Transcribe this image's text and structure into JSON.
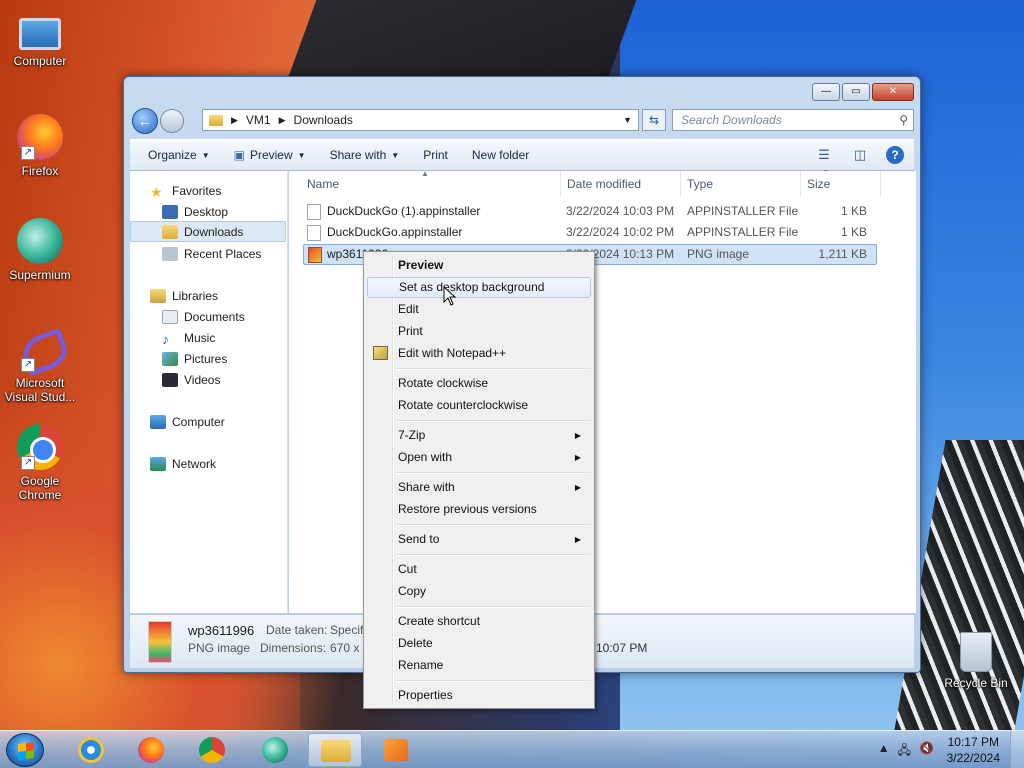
{
  "desktop": {
    "icons": [
      {
        "label": "Computer"
      },
      {
        "label": "Firefox"
      },
      {
        "label": "Supermium"
      },
      {
        "label": "Microsoft Visual Stud..."
      },
      {
        "label": "Google Chrome"
      },
      {
        "label": "Recycle Bin"
      }
    ]
  },
  "window": {
    "controls": {
      "minimize": "—",
      "maximize": "▭",
      "close": "✕"
    },
    "address": {
      "segments": [
        "VM1",
        "Downloads"
      ]
    },
    "search": {
      "placeholder": "Search Downloads"
    },
    "toolbar": {
      "organize": "Organize",
      "preview": "Preview",
      "share_with": "Share with",
      "print": "Print",
      "new_folder": "New folder"
    },
    "nav": {
      "favorites": "Favorites",
      "desktop": "Desktop",
      "downloads": "Downloads",
      "recent_places": "Recent Places",
      "libraries": "Libraries",
      "documents": "Documents",
      "music": "Music",
      "pictures": "Pictures",
      "videos": "Videos",
      "computer": "Computer",
      "network": "Network"
    },
    "columns": {
      "name": "Name",
      "date_modified": "Date modified",
      "type": "Type",
      "size": "Size"
    },
    "files": [
      {
        "name": "DuckDuckGo (1).appinstaller",
        "date": "3/22/2024 10:03 PM",
        "type": "APPINSTALLER File",
        "size": "1 KB"
      },
      {
        "name": "DuckDuckGo.appinstaller",
        "date": "3/22/2024 10:02 PM",
        "type": "APPINSTALLER File",
        "size": "1 KB"
      },
      {
        "name": "wp3611996",
        "date": "3/22/2024 10:13 PM",
        "type": "PNG image",
        "size": "1,211 KB"
      }
    ],
    "details": {
      "name": "wp3611996",
      "type": "PNG image",
      "date_taken_label": "Date taken:",
      "date_taken_value": "Specify",
      "dimensions_label": "Dimensions:",
      "dimensions_value": "670 x 1",
      "time_visible": "10:07 PM"
    }
  },
  "context_menu": {
    "items": [
      {
        "label": "Preview"
      },
      {
        "label": "Set as desktop background"
      },
      {
        "label": "Edit"
      },
      {
        "label": "Print"
      },
      {
        "label": "Edit with Notepad++"
      },
      {
        "label": "Rotate clockwise"
      },
      {
        "label": "Rotate counterclockwise"
      },
      {
        "label": "7-Zip"
      },
      {
        "label": "Open with"
      },
      {
        "label": "Share with"
      },
      {
        "label": "Restore previous versions"
      },
      {
        "label": "Send to"
      },
      {
        "label": "Cut"
      },
      {
        "label": "Copy"
      },
      {
        "label": "Create shortcut"
      },
      {
        "label": "Delete"
      },
      {
        "label": "Rename"
      },
      {
        "label": "Properties"
      }
    ]
  },
  "taskbar": {
    "time": "10:17 PM",
    "date": "3/22/2024"
  }
}
